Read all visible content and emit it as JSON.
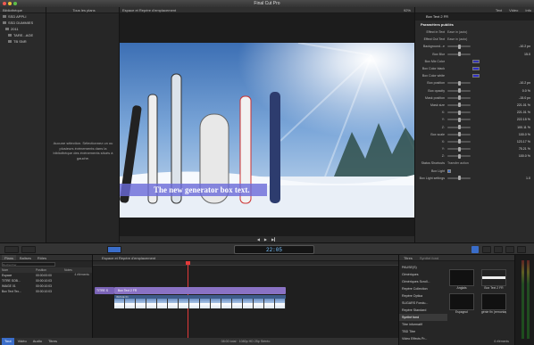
{
  "app": {
    "title": "Final Cut Pro"
  },
  "library": {
    "header": "Bibliothèque",
    "items": [
      {
        "label": "SSD APPLI",
        "indent": 1
      },
      {
        "label": "SSD DUMMIES",
        "indent": 1
      },
      {
        "label": "2011",
        "indent": 2
      },
      {
        "label": "TARE...AGE",
        "indent": 3
      },
      {
        "label": "TB SNR",
        "indent": 3
      }
    ]
  },
  "browser": {
    "header": "Tous les plans",
    "empty_message": "Aucune sélection. Sélectionnez un ou plusieurs évènements dans la bibliothèque des évènements situés à gauche."
  },
  "viewer": {
    "header": "Espace et Repère d'emplacement",
    "zoom": "92%",
    "overlay_text": "The new generator box text."
  },
  "inspector": {
    "tabs": [
      "Text",
      "Video",
      "Info"
    ],
    "clip_name": "Box Text 2 FR",
    "section_title": "Paramètres publiés",
    "rows": [
      {
        "label": "Effect in Text",
        "value": "Ease in (auto)",
        "type": "text"
      },
      {
        "label": "Effect Out Text",
        "value": "Ease in (auto)",
        "type": "text"
      },
      {
        "label": "Background...e",
        "value": "-10.2 px",
        "type": "slider"
      },
      {
        "label": "Box Blur",
        "value": "15.0",
        "type": "slider"
      },
      {
        "label": "Box Mix Color",
        "value": "",
        "type": "swatch",
        "color": "#3535b5"
      },
      {
        "label": "Box Color black",
        "value": "",
        "type": "swatch",
        "color": "#2f2fc8"
      },
      {
        "label": "Box Color white",
        "value": "",
        "type": "swatch",
        "color": "#2f2fc8"
      },
      {
        "label": "Box position",
        "value": "-10.2 px",
        "type": "slider"
      },
      {
        "label": "Box opacity",
        "value": "0.0 %",
        "type": "slider"
      },
      {
        "label": "Mask position",
        "value": "-15.0 px",
        "type": "slider"
      },
      {
        "label": "Mask size",
        "value": "221.01 %",
        "type": "slider"
      },
      {
        "label": "X:",
        "value": "221.01 %",
        "type": "slider"
      },
      {
        "label": "Y:",
        "value": "222.15 %",
        "type": "slider"
      },
      {
        "label": "Z:",
        "value": "100.11 %",
        "type": "slider"
      },
      {
        "label": "Box scale",
        "value": "100.0 %",
        "type": "slider"
      },
      {
        "label": "X:",
        "value": "123.17 %",
        "type": "slider"
      },
      {
        "label": "Y:",
        "value": "75.21 %",
        "type": "slider"
      },
      {
        "label": "Z:",
        "value": "100.0 %",
        "type": "slider"
      },
      {
        "label": "Status Shortcuts",
        "value": "Transfer action",
        "type": "text"
      },
      {
        "label": "Box Light",
        "value": "",
        "type": "check"
      },
      {
        "label": "Box Light settings",
        "value": "1.0",
        "type": "slider"
      }
    ]
  },
  "timeline": {
    "header": "Espace et Repère d'emplacement",
    "index_tabs": [
      "Plans",
      "Balises",
      "Rôles"
    ],
    "search_placeholder": "Rechercher",
    "columns": [
      "Nom",
      "Position",
      "Notes"
    ],
    "rows": [
      {
        "name": "Espace",
        "pos": "00:00:00:00",
        "notes": ""
      },
      {
        "name": "TITRE SOB...",
        "pos": "00:00:10:03",
        "notes": ""
      },
      {
        "name": "IMAGE 01",
        "pos": "00:00:10:03",
        "notes": ""
      },
      {
        "name": "Box Text Tex...",
        "pos": "00:00:10:03",
        "notes": ""
      }
    ],
    "item_count": "4 éléments",
    "bottom_tabs": [
      "Tout",
      "Vidéo",
      "Audio",
      "Titres"
    ],
    "clip_label": "Box Text 2 FR",
    "clip_left_label": "TITRE S",
    "video_label": "IMAGE 01",
    "status": "08:00 total · 1080p HD 25p Stéréo",
    "timecode": "22:05"
  },
  "titles_browser": {
    "tabs": [
      "Titres",
      "Synthé fond"
    ],
    "categories": [
      "PAUSE(S)",
      "Génériques",
      "Génériques Scroll...",
      "Repère Collection",
      "Repère Optica",
      "SUGARS Fondu...",
      "Repère Standard",
      "Synthé fond",
      "Titre informatif",
      "TBD Titre",
      "Video Effects Pr..."
    ],
    "selected_index": 7,
    "items": [
      {
        "label": "Anglais",
        "style": "dark"
      },
      {
        "label": "Box Text 2 FR",
        "style": "white"
      },
      {
        "label": "Espagnol",
        "style": "dark"
      },
      {
        "label": "génie fin (remontage haut)",
        "style": "dark"
      }
    ],
    "count": "6 éléments"
  }
}
